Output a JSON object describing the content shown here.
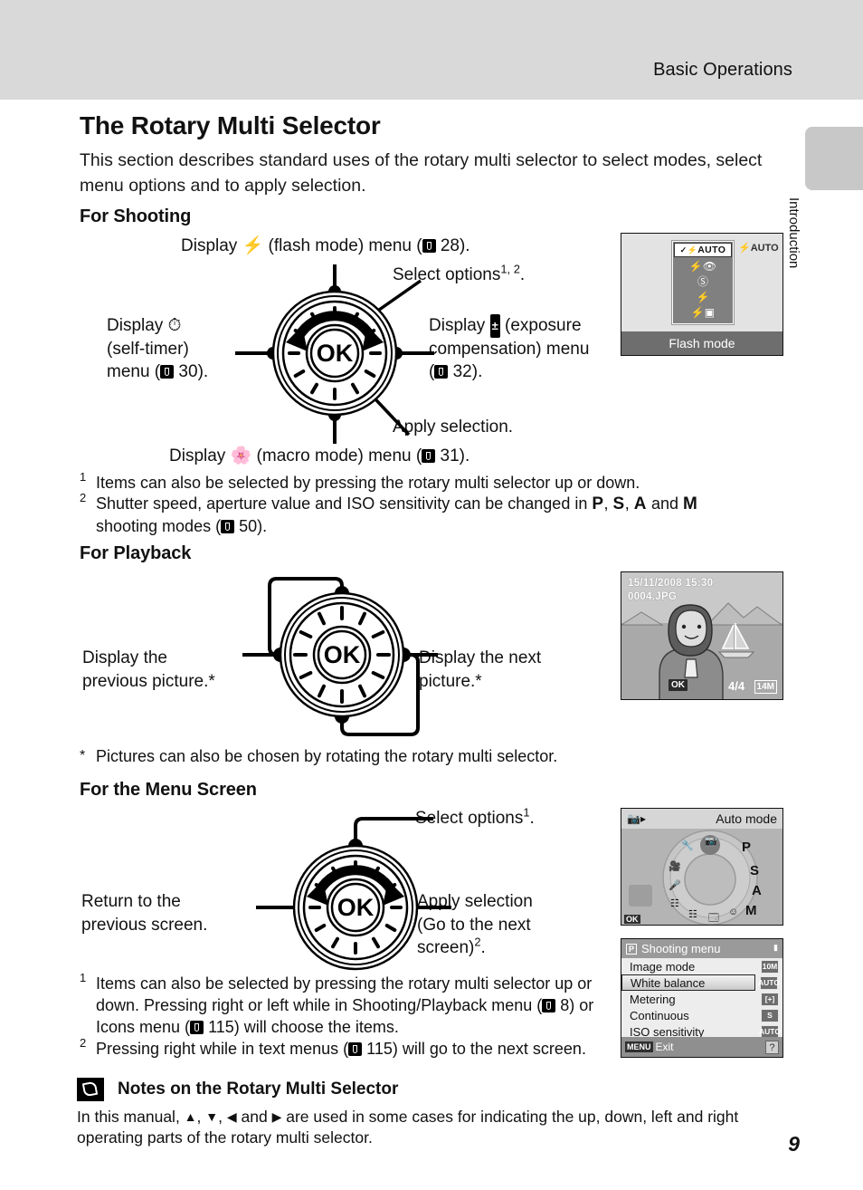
{
  "header": {
    "title": "Basic Operations",
    "side_tab": "Introduction"
  },
  "page_number": "9",
  "title": "The Rotary Multi Selector",
  "intro": "This section describes standard uses of the rotary multi selector to select modes, select menu options and to apply selection.",
  "sections": {
    "shooting": {
      "heading": "For Shooting",
      "labels": {
        "top": {
          "pre": "Display",
          "icon": "flash-icon",
          "mid": "(flash mode) menu (",
          "ref": "28",
          "post": ")."
        },
        "top_right": "Select options",
        "top_right_sup": "1, 2",
        "top_right_end": ".",
        "left": {
          "l1_pre": "Display",
          "l1_icon": "self-timer-icon",
          "l2": "(self-timer)",
          "l3_pre": "menu (",
          "l3_ref": "30",
          "l3_post": ")."
        },
        "right": {
          "l1_pre": "Display",
          "l1_icon": "exposure-compensation-icon",
          "l1_post": "(exposure",
          "l2": "compensation) menu",
          "l3_pre": "(",
          "l3_ref": "32",
          "l3_post": ")."
        },
        "bottom_right": "Apply selection.",
        "bottom": {
          "pre": "Display",
          "icon": "macro-icon",
          "mid": "(macro mode) menu (",
          "ref": "31",
          "post": ")."
        }
      },
      "footnotes": [
        {
          "num": "1",
          "text": "Items can also be selected by pressing the rotary multi selector up or down."
        },
        {
          "num": "2",
          "text_a": "Shutter speed, aperture value and ISO sensitivity can be changed in ",
          "modes": [
            "P",
            "S",
            "A"
          ],
          "and": " and ",
          "mode_m": "M",
          "text_b": "shooting modes (",
          "ref": "50",
          "text_c": ")."
        }
      ]
    },
    "playback": {
      "heading": "For Playback",
      "labels": {
        "left_l1": "Display the",
        "left_l2": "previous picture.*",
        "right_l1": "Display the next",
        "right_l2": "picture.*"
      },
      "footnote": {
        "mark": "*",
        "text": "Pictures can also be chosen by rotating the rotary multi selector."
      }
    },
    "menu": {
      "heading": "For the Menu Screen",
      "labels": {
        "top": "Select options",
        "top_sup": "1",
        "top_end": ".",
        "left_l1": "Return to the",
        "left_l2": "previous screen.",
        "right_l1": "Apply selection",
        "right_l2": "(Go to the next",
        "right_l3": "screen)",
        "right_sup": "2",
        "right_end": "."
      },
      "footnotes": [
        {
          "num": "1",
          "text_a": "Items can also be selected by pressing the rotary multi selector up or down. Pressing right or left while in Shooting/Playback menu (",
          "ref_a": "8",
          "text_b": ") or Icons menu (",
          "ref_b": "115",
          "text_c": ") will choose the items."
        },
        {
          "num": "2",
          "text_a": "Pressing right while in text menus (",
          "ref_a": "115",
          "text_b": ") will go to the next screen."
        }
      ]
    }
  },
  "dial": {
    "ok_label": "OK"
  },
  "screens": {
    "flash": {
      "caption": "Flash mode",
      "selected_label": "AUTO",
      "options": [
        "flash-auto",
        "red-eye-reduction",
        "flash-off",
        "fill-flash",
        "slow-sync"
      ],
      "side_indicator": "AUTO"
    },
    "playback": {
      "datetime": "15/11/2008 15:30",
      "filename": "0004.JPG",
      "ok_badge": "OK",
      "frame_counter": "4/4",
      "image_size": "14M"
    },
    "auto_mode": {
      "title": "Auto mode",
      "ok_badge": "OK",
      "mode_letters": [
        "P",
        "S",
        "A",
        "M"
      ],
      "icons": [
        "setup-icon",
        "movie-icon",
        "voice-recording-icon",
        "scene-auto-icon",
        "scene-icon",
        "list-by-date-icon",
        "smart-portrait-icon",
        "camera-auto-icon"
      ]
    },
    "shooting_menu": {
      "title": "Shooting menu",
      "items": [
        {
          "label": "Image mode",
          "badge": "10M",
          "selected": false
        },
        {
          "label": "White balance",
          "badge": "AUTO",
          "selected": true
        },
        {
          "label": "Metering",
          "badge": "[+]",
          "selected": false
        },
        {
          "label": "Continuous",
          "badge": "S",
          "selected": false
        },
        {
          "label": "ISO sensitivity",
          "badge": "AUTO",
          "selected": false
        }
      ],
      "exit_tag": "MENU",
      "exit_label": "Exit",
      "help": "?"
    }
  },
  "notes": {
    "title": "Notes on the Rotary Multi Selector",
    "body_a": "In this manual, ",
    "up": "▲",
    "sep1": ", ",
    "down": "▼",
    "sep2": ", ",
    "left": "◀",
    "and": " and ",
    "right": "▶",
    "body_b": " are used in some cases for indicating the up, down, left and right operating parts of the rotary multi selector."
  }
}
